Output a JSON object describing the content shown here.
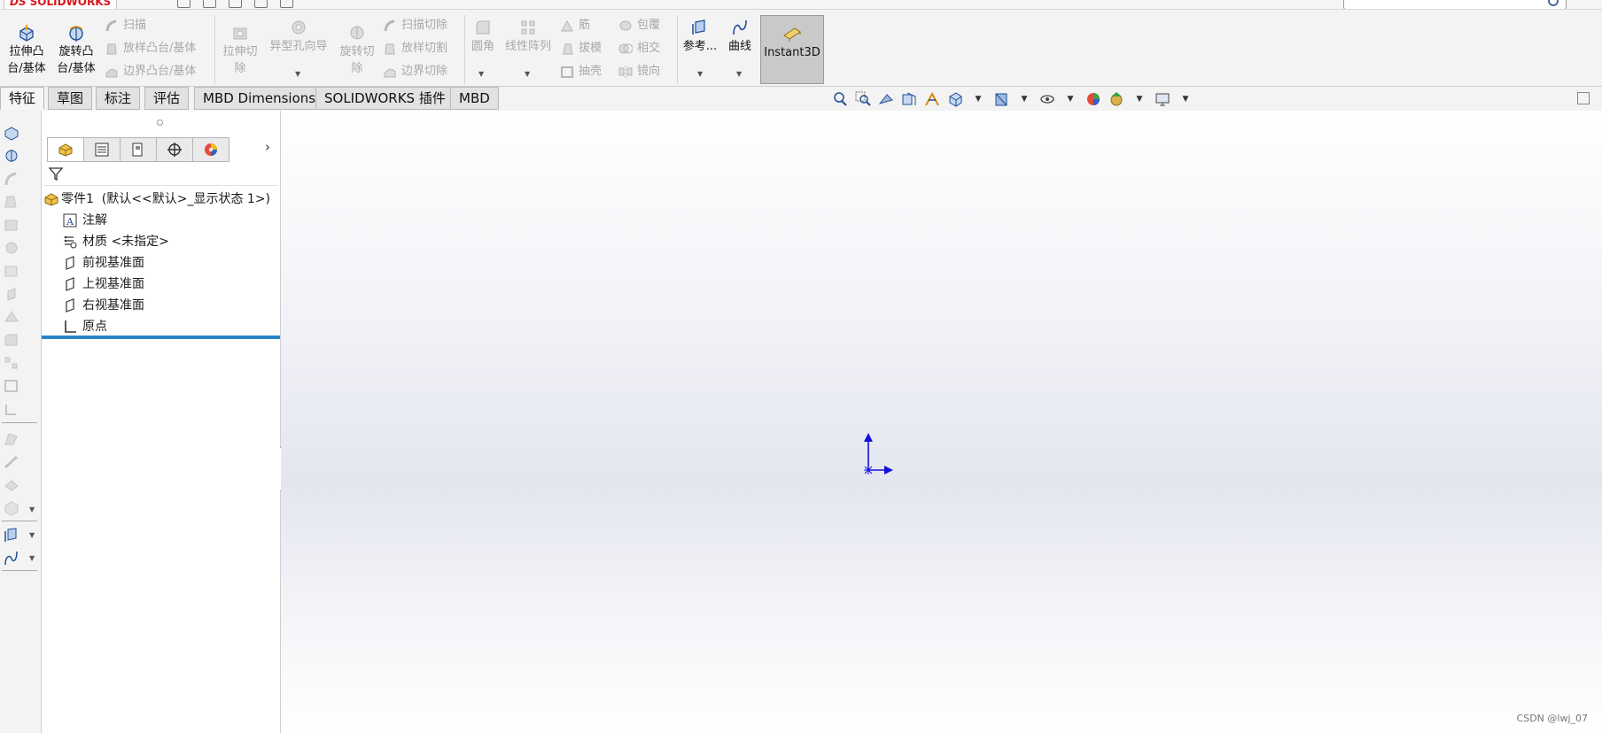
{
  "app": {
    "logo_text": "SOLIDWORKS",
    "logo_prefix": "DS"
  },
  "ribbon": {
    "extrude_boss": "拉伸凸\n台/基体",
    "revolve_boss": "旋转凸\n台/基体",
    "sweep": "扫描",
    "loft_boss": "放样凸台/基体",
    "boundary_boss": "边界凸台/基体",
    "extrude_cut": "拉伸切\n除",
    "hole_wizard": "异型孔向导",
    "revolve_cut": "旋转切\n除",
    "swept_cut": "扫描切除",
    "lofted_cut": "放样切割",
    "boundary_cut": "边界切除",
    "fillet": "圆角",
    "linear_pattern": "线性阵列",
    "rib": "筋",
    "draft": "拔模",
    "shell": "抽壳",
    "wrap": "包覆",
    "intersect": "相交",
    "mirror": "镜向",
    "reference": "参考...",
    "curves": "曲线",
    "instant3d": "Instant3D"
  },
  "tabs": [
    "特征",
    "草图",
    "标注",
    "评估",
    "MBD Dimensions",
    "SOLIDWORKS 插件",
    "MBD"
  ],
  "feature_tree": {
    "root": "零件1  (默认<<默认>_显示状态 1>)",
    "items": [
      "注解",
      "材质 <未指定>",
      "前视基准面",
      "上视基准面",
      "右视基准面",
      "原点"
    ]
  },
  "watermark": "CSDN @lwj_07",
  "colors": {
    "accent": "#2b83c8",
    "logo": "#d71920",
    "triad": "#1212d8"
  }
}
